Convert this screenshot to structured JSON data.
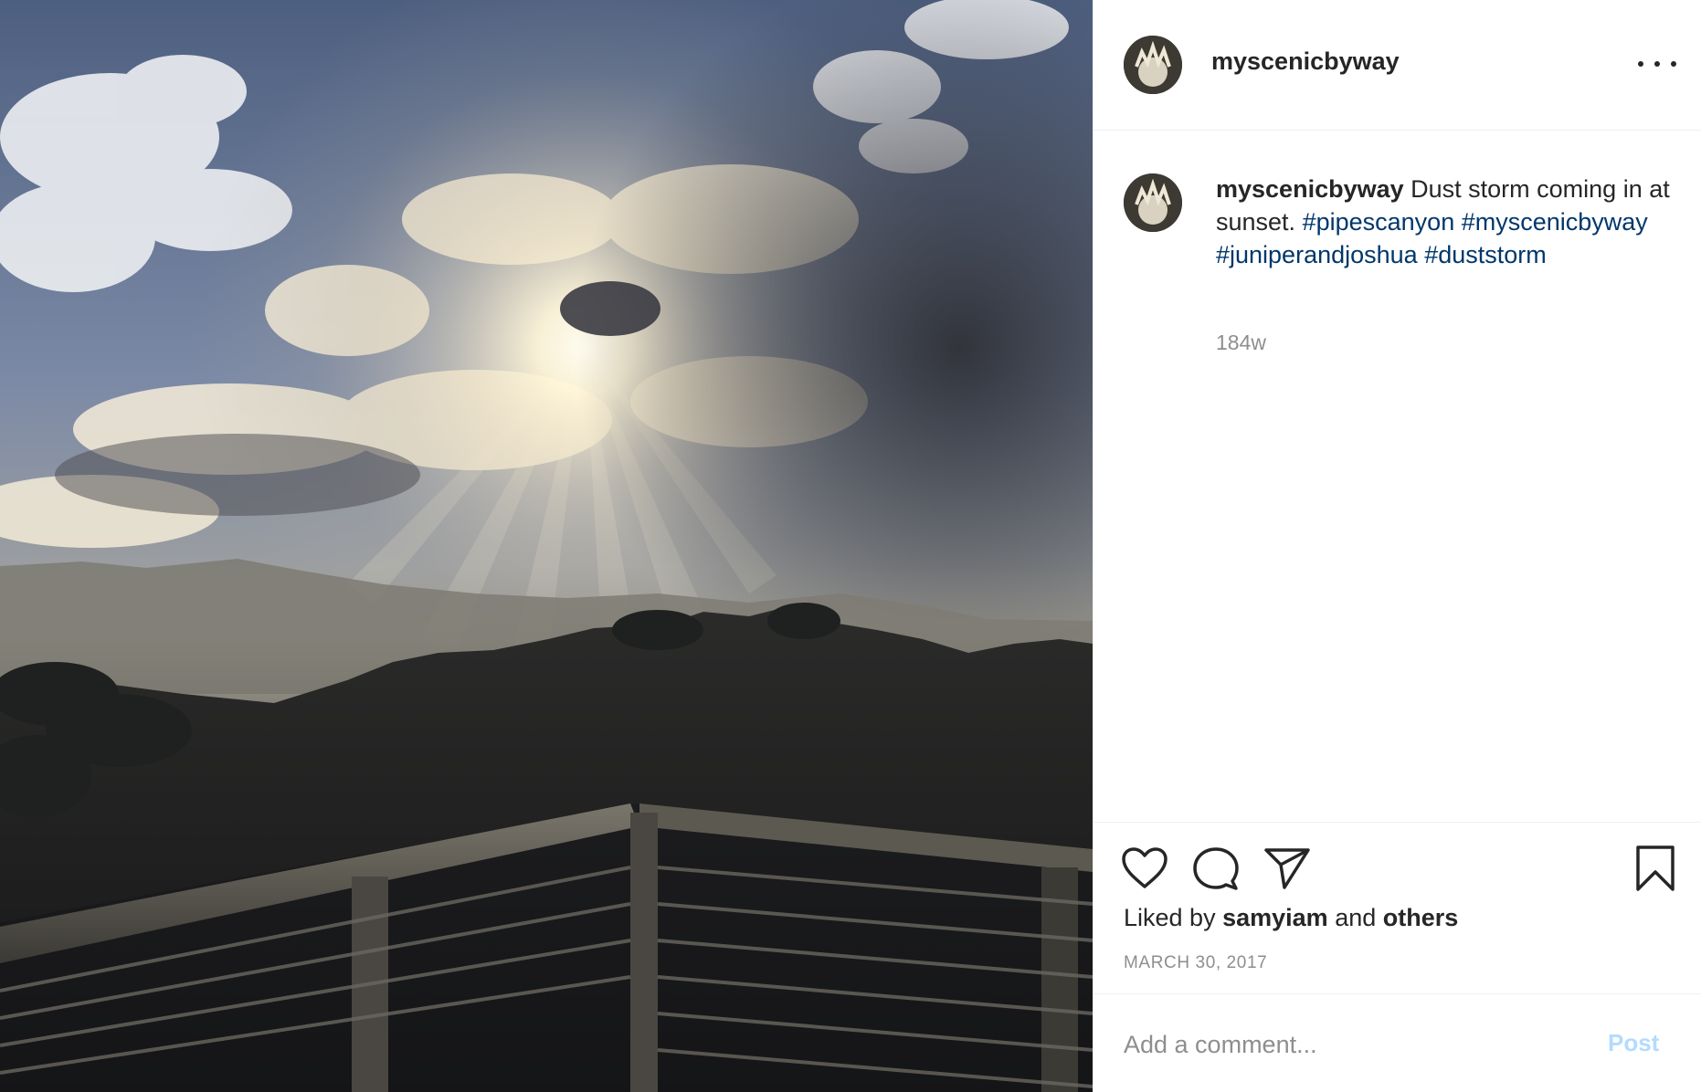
{
  "header": {
    "username": "myscenicbyway"
  },
  "caption": {
    "username": "myscenicbyway",
    "text": "Dust storm coming in at sunset.",
    "hashtags": [
      "#pipescanyon",
      "#myscenicbyway",
      "#juniperandjoshua",
      "#duststorm"
    ],
    "age": "184w"
  },
  "likes": {
    "prefix": "Liked by",
    "user": "samyiam",
    "joiner": "and",
    "others": "others"
  },
  "date": "MARCH 30, 2017",
  "comment_box": {
    "placeholder": "Add a comment...",
    "post_label": "Post"
  },
  "icons": {
    "more": "more-options-icon",
    "like": "heart-icon",
    "comment": "comment-bubble-icon",
    "share": "paper-plane-icon",
    "save": "bookmark-icon"
  },
  "colors": {
    "hashtag": "#00376b",
    "muted": "#8e8e8e",
    "post_button": "#b3dbff",
    "text": "#262626"
  }
}
